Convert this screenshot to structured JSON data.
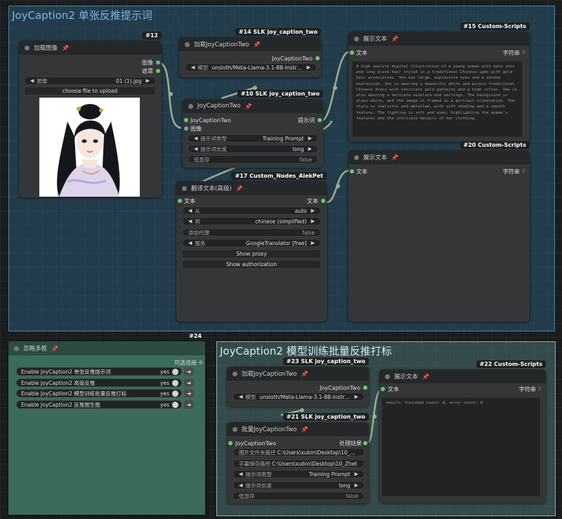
{
  "groups": {
    "top_title": "JoyCaption2 单张反推提示词",
    "bottom_title": "JoyCaption2 模型训练批量反推打标"
  },
  "nodes": {
    "load_image": {
      "badge": "#12",
      "title": "加载图像",
      "out_image": "图像",
      "out_mask": "遮罩",
      "image_label": "图像",
      "image_value": "01 (1).jpg",
      "upload_label": "choose file to upload"
    },
    "loader_top": {
      "badge": "#14 SLK joy_caption_two",
      "title": "加载JoyCaptionTwo",
      "output": "JoyCaptionTwo",
      "model_label": "模型",
      "model_value": "unsloth/Meta-Llama-3.1-8B-Instruct..."
    },
    "joycaption_top": {
      "badge": "#10 SLK joy_caption_two",
      "title": "JoyCaptionTwo",
      "in_model": "JoyCaptionTwo",
      "in_image": "图像",
      "output": "提示词",
      "prompt_type_label": "提示词类型",
      "prompt_type_value": "Training Prompt",
      "length_label": "提示词长度",
      "length_value": "long",
      "lowmem_label": "低显存",
      "lowmem_value": "false"
    },
    "show_text_15": {
      "badge": "#15 Custom-Scripts",
      "title": "展示文本",
      "in_text": "文本",
      "out_string": "字符串",
      "content": "A high quality digital illustration of a young woman with pale skin and long black hair styled in a traditional Chinese updo with gold hair accessories. She has large, expressive eyes and a serene expression. She is wearing a beautiful white and purple traditional Chinese dress with intricate gold patterns and a high collar. She is also wearing a delicate necklace and earrings. The background is plain white, and the image is framed in a portrait orientation. The style is realistic and detailed, with soft shading and a smooth texture. The lighting is soft and even, highlighting the woman's features and the intricate details of her clothing."
    },
    "show_text_20": {
      "badge": "#20 Custom-Scripts",
      "title": "展示文本",
      "in_text": "文本",
      "out_string": "字符串"
    },
    "translate": {
      "badge": "#17 Custom_Nodes_AlekPet",
      "title": "翻译文本(高级)",
      "in_text": "文本",
      "out_text": "文本",
      "from_label": "从",
      "from_value": "auto",
      "to_label": "到",
      "to_value": "chinese (simplified)",
      "proxy_label": "添加代理",
      "proxy_value": "false",
      "service_label": "服务",
      "service_value": "GoogleTranslator [free]",
      "show_proxy": "Show proxy",
      "show_auth": "Show authorization"
    },
    "bypasser": {
      "badge": "#24",
      "title": "忽略多框",
      "optional": "可选连接",
      "rows": [
        {
          "label": "Enable JoyCaption2 单张反推提示词",
          "value": "yes"
        },
        {
          "label": "Enable JoyCaption2 高级反推",
          "value": "yes"
        },
        {
          "label": "Enable JoyCaption2 模型训练批量反推打标",
          "value": "yes"
        },
        {
          "label": "Enable JoyCaption2 反推图生图",
          "value": "yes"
        }
      ]
    },
    "loader_bottom": {
      "badge": "#23 SLK joy_caption_two",
      "title": "加载JoyCaptionTwo",
      "output": "JoyCaptionTwo",
      "model_label": "模型",
      "model_value": "unsloth/Meta-Llama-3.1-8B-Instruct..."
    },
    "batch": {
      "badge": "#21 SLK joy_caption_two",
      "title": "批量JoyCaptionTwo",
      "in_model": "JoyCaptionTwo",
      "output": "处理结果",
      "folder_label": "图片文件夹路径",
      "folder_value": "C:\\Users\\xubin\\Desktop\\10_Zhet",
      "save_label": "字幕保存路径",
      "save_value": "C:\\Users\\xubin\\Desktop\\10_Zhet",
      "prompt_type_label": "提示词类型",
      "prompt_type_value": "Training Prompt",
      "length_label": "提示词长度",
      "length_value": "long",
      "lowmem_label": "低显存",
      "lowmem_value": "false"
    },
    "show_text_22": {
      "badge": "#22 Custom-Scripts",
      "title": "展示文本",
      "in_text": "文本",
      "out_string": "字符串",
      "content": "result: finished count: 8, error count: 0"
    }
  },
  "colors": {
    "link": "#9ab08a",
    "slot_green": "#66cc66",
    "pin": "#dd3333"
  },
  "icons": [
    "pin-icon",
    "grid-icon",
    "arrow-left-icon",
    "arrow-right-icon",
    "go-arrow-icon"
  ]
}
